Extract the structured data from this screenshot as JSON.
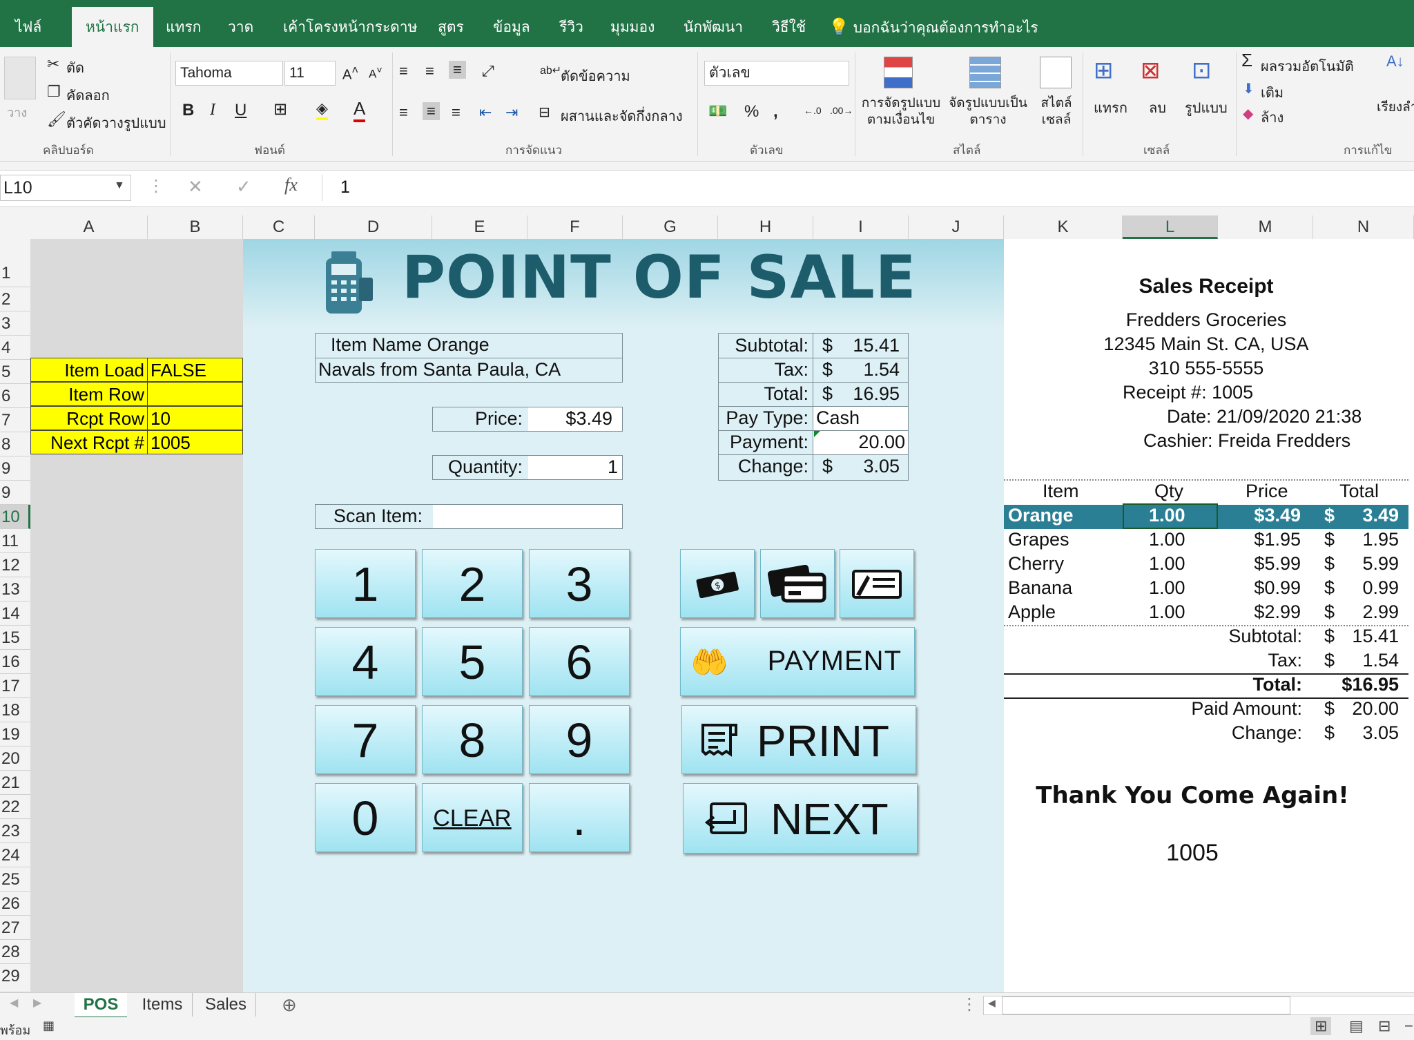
{
  "ribbon": {
    "tabs": [
      "ไฟล์",
      "หน้าแรก",
      "แทรก",
      "วาด",
      "เค้าโครงหน้ากระดาษ",
      "สูตร",
      "ข้อมูล",
      "รีวิว",
      "มุมมอง",
      "นักพัฒนา",
      "วิธีใช้"
    ],
    "tell_me": "บอกฉันว่าคุณต้องการทำอะไร",
    "clipboard": {
      "cut": "ตัด",
      "copy": "คัดลอก",
      "format_painter": "ตัวคัดวางรูปแบบ",
      "paste": "วาง",
      "group": "คลิปบอร์ด"
    },
    "font": {
      "name": "Tahoma",
      "size": "11",
      "group": "ฟอนต์"
    },
    "alignment": {
      "wrap": "ตัดข้อความ",
      "merge": "ผสานและจัดกึ่งกลาง",
      "group": "การจัดแนว"
    },
    "number": {
      "format": "ตัวเลข",
      "group": "ตัวเลข"
    },
    "styles": {
      "conditional": "การจัดรูปแบบตามเงื่อนไข",
      "table": "จัดรูปแบบเป็นตาราง",
      "cell": "สไตล์เซลล์",
      "group": "สไตล์"
    },
    "cells": {
      "insert": "แทรก",
      "delete": "ลบ",
      "format": "รูปแบบ",
      "group": "เซลล์"
    },
    "editing": {
      "autosum": "ผลรวมอัตโนมัติ",
      "fill": "เติม",
      "clear": "ล้าง",
      "sort": "เรียงลำดับและกรอง",
      "group": "การแก้ไข"
    }
  },
  "formula_bar": {
    "name_box": "L10",
    "fx": "fx",
    "value": "1"
  },
  "columns": [
    "A",
    "B",
    "C",
    "D",
    "E",
    "F",
    "G",
    "H",
    "I",
    "J",
    "K",
    "L",
    "M",
    "N"
  ],
  "rows": [
    "1",
    "2",
    "3",
    "4",
    "5",
    "6",
    "7",
    "8",
    "9",
    "10",
    "11",
    "12",
    "13",
    "14",
    "15",
    "16",
    "17",
    "18",
    "19",
    "20",
    "21",
    "22",
    "23",
    "24",
    "25",
    "26",
    "27",
    "28",
    "29"
  ],
  "left_panel": [
    {
      "label": "Item Load",
      "value": "FALSE"
    },
    {
      "label": "Item Row",
      "value": ""
    },
    {
      "label": "Rcpt Row",
      "value": "10"
    },
    {
      "label": "Next Rcpt #",
      "value": "1005"
    }
  ],
  "pos": {
    "title": "POINT OF SALE",
    "item_line1": "Item Name Orange",
    "item_line2": "Navals from Santa Paula, CA",
    "price_label": "Price:",
    "price": "$3.49",
    "qty_label": "Quantity:",
    "qty": "1",
    "scan_label": "Scan Item:",
    "scan_value": "",
    "subtotal_label": "Subtotal:",
    "subtotal": "15.41",
    "tax_label": "Tax:",
    "tax": "1.54",
    "total_label": "Total:",
    "total": "16.95",
    "paytype_label": "Pay Type:",
    "paytype": "Cash",
    "payment_label": "Payment:",
    "payment": "20.00",
    "change_label": "Change:",
    "change": "3.05",
    "currency": "$",
    "keys": [
      "1",
      "2",
      "3",
      "4",
      "5",
      "6",
      "7",
      "8",
      "9",
      "0",
      "CLEAR",
      "."
    ],
    "payment_button": "PAYMENT",
    "print_button": "PRINT",
    "next_button": "NEXT"
  },
  "receipt": {
    "title": "Sales Receipt",
    "store": "Fredders Groceries",
    "address": "12345 Main St. CA, USA",
    "phone": "310 555-5555",
    "receipt_no": "Receipt #: 1005",
    "date": "Date: 21/09/2020 21:38",
    "cashier": "Cashier: Freida Fredders",
    "headers": {
      "item": "Item",
      "qty": "Qty",
      "price": "Price",
      "total": "Total"
    },
    "items": [
      {
        "item": "Orange",
        "qty": "1.00",
        "price": "$3.49",
        "cur": "$",
        "total": "3.49"
      },
      {
        "item": "Grapes",
        "qty": "1.00",
        "price": "$1.95",
        "cur": "$",
        "total": "1.95"
      },
      {
        "item": "Cherry",
        "qty": "1.00",
        "price": "$5.99",
        "cur": "$",
        "total": "5.99"
      },
      {
        "item": "Banana",
        "qty": "1.00",
        "price": "$0.99",
        "cur": "$",
        "total": "0.99"
      },
      {
        "item": "Apple",
        "qty": "1.00",
        "price": "$2.99",
        "cur": "$",
        "total": "2.99"
      }
    ],
    "subtotal_label": "Subtotal:",
    "subtotal": "15.41",
    "tax_label": "Tax:",
    "tax": "1.54",
    "total_label": "Total:",
    "total": "$16.95",
    "paid_label": "Paid Amount:",
    "paid": "20.00",
    "change_label": "Change:",
    "change": "3.05",
    "currency": "$",
    "thanks": "Thank You Come Again!",
    "footer_no": "1005"
  },
  "sheets": [
    "POS",
    "Items",
    "Sales"
  ],
  "status": {
    "ready": "พร้อม"
  },
  "colors": {
    "excel_green": "#217346",
    "pos_bg": "#ddf0f5",
    "title": "#1d5c6b",
    "highlight_row": "#2b7f94",
    "input_yellow": "#ffff00"
  }
}
